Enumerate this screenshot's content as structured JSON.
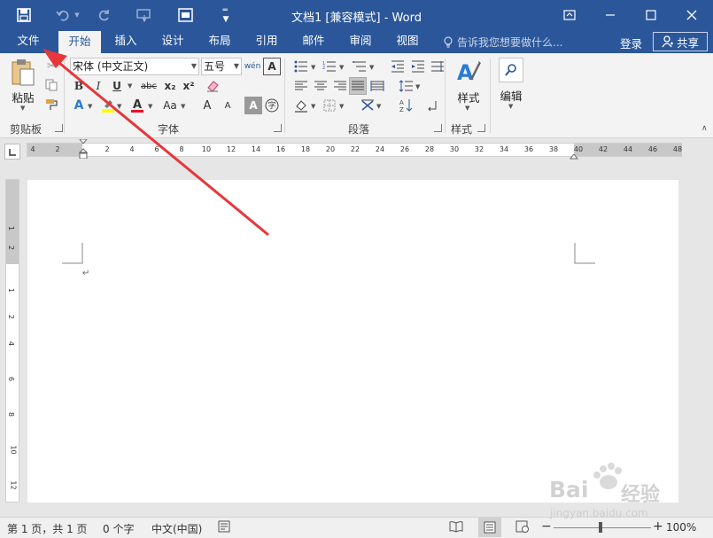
{
  "titlebar": {
    "title": "文档1 [兼容模式] - Word",
    "qat": [
      "save-icon",
      "undo-icon",
      "redo-icon",
      "touch-mode-icon",
      "print-preview-icon",
      "customize-qat-icon"
    ],
    "window_buttons": [
      "ribbon-display-options",
      "minimize",
      "maximize",
      "close"
    ]
  },
  "tabs": {
    "file": "文件",
    "items": [
      {
        "label": "开始",
        "active": true
      },
      {
        "label": "插入",
        "active": false
      },
      {
        "label": "设计",
        "active": false
      },
      {
        "label": "布局",
        "active": false
      },
      {
        "label": "引用",
        "active": false
      },
      {
        "label": "邮件",
        "active": false
      },
      {
        "label": "审阅",
        "active": false
      },
      {
        "label": "视图",
        "active": false
      }
    ],
    "tell_me": "告诉我您想要做什么...",
    "login": "登录",
    "share": "共享"
  },
  "ribbon": {
    "clipboard": {
      "paste": "粘贴",
      "label": "剪贴板"
    },
    "font": {
      "font_name": "宋体 (中文正文)",
      "font_size": "五号",
      "bold": "B",
      "italic": "I",
      "underline": "U",
      "strike": "abc",
      "subscript": "x₂",
      "superscript": "x²",
      "change_case": "Aa",
      "grow": "A",
      "shrink": "A",
      "label": "字体"
    },
    "paragraph": {
      "label": "段落"
    },
    "styles": {
      "button": "样式",
      "label": "样式"
    },
    "editing": {
      "button": "编辑"
    }
  },
  "ruler": {
    "ticks": [
      "4",
      "2",
      "2",
      "4",
      "6",
      "8",
      "10",
      "12",
      "14",
      "16",
      "18",
      "20",
      "22",
      "24",
      "26",
      "28",
      "30",
      "32",
      "34",
      "36",
      "38",
      "40",
      "42",
      "44",
      "46",
      "48"
    ],
    "vticks": [
      "1",
      "2",
      "1",
      "2",
      "4",
      "6",
      "8",
      "10",
      "12"
    ]
  },
  "statusbar": {
    "page": "第 1 页，共 1 页",
    "words": "0 个字",
    "language": "中文(中国)",
    "zoom": "100%"
  },
  "watermark": {
    "brand": "Bai",
    "brand2": "经验",
    "url": "jingyan.baidu.com"
  },
  "colors": {
    "accent": "#2b579a",
    "highlight": "#ffff00",
    "font_color": "#e81123",
    "arrow": "#e8363a"
  }
}
